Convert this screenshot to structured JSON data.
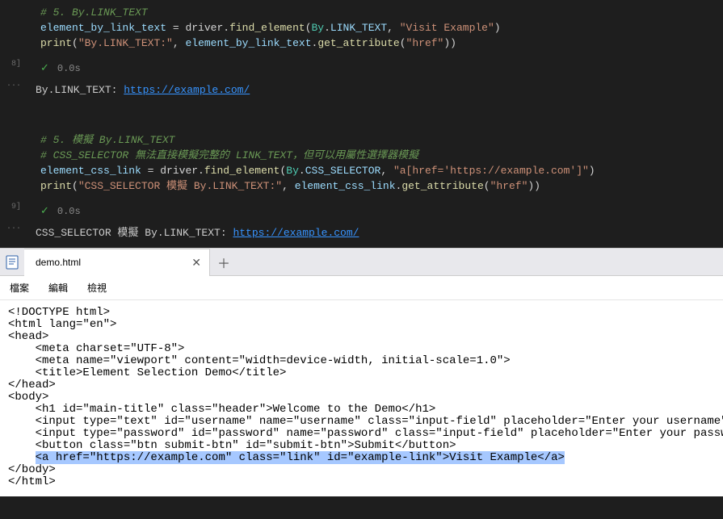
{
  "cell1": {
    "gutter": "8]",
    "comment": "# 5. By.LINK_TEXT",
    "line2": {
      "var": "element_by_link_text",
      "eq": " = ",
      "obj": "driver",
      "dot1": ".",
      "func": "find_element",
      "open": "(",
      "cls": "By",
      "dot2": ".",
      "prop": "LINK_TEXT",
      "comma": ", ",
      "str": "\"Visit Example\"",
      "close": ")"
    },
    "line3": {
      "print": "print",
      "open": "(",
      "str1": "\"By.LINK_TEXT:\"",
      "comma": ", ",
      "var": "element_by_link_text",
      "dot": ".",
      "func": "get_attribute",
      "open2": "(",
      "str2": "\"href\"",
      "close": "))"
    },
    "status_time": "0.0s"
  },
  "out1": {
    "label": "By.LINK_TEXT: ",
    "url": "https://example.com/"
  },
  "cell2": {
    "gutter": "9]",
    "comment1": "# 5. 模擬 By.LINK_TEXT",
    "comment2": "# CSS_SELECTOR 無法直接模擬完整的 LINK_TEXT，但可以用屬性選擇器模擬",
    "line3": {
      "var": "element_css_link",
      "eq": " = ",
      "obj": "driver",
      "dot1": ".",
      "func": "find_element",
      "open": "(",
      "cls": "By",
      "dot2": ".",
      "prop": "CSS_SELECTOR",
      "comma": ", ",
      "str": "\"a[href='https://example.com']\"",
      "close": ")"
    },
    "line4": {
      "print": "print",
      "open": "(",
      "str1": "\"CSS_SELECTOR 模擬 By.LINK_TEXT:\"",
      "comma": ", ",
      "var": "element_css_link",
      "dot": ".",
      "func": "get_attribute",
      "open2": "(",
      "str2": "\"href\"",
      "close": "))"
    },
    "status_time": "0.0s"
  },
  "out2": {
    "label": "CSS_SELECTOR 模擬 By.LINK_TEXT: ",
    "url": "https://example.com/"
  },
  "editor": {
    "tab_name": "demo.html",
    "menu": {
      "file": "檔案",
      "edit": "編輯",
      "view": "檢視"
    },
    "code": {
      "l1": "<!DOCTYPE html>",
      "l2": "<html lang=\"en\">",
      "l3": "<head>",
      "l4": "    <meta charset=\"UTF-8\">",
      "l5": "    <meta name=\"viewport\" content=\"width=device-width, initial-scale=1.0\">",
      "l6": "    <title>Element Selection Demo</title>",
      "l7": "</head>",
      "l8": "<body>",
      "l9": "    <h1 id=\"main-title\" class=\"header\">Welcome to the Demo</h1>",
      "l10": "    <input type=\"text\" id=\"username\" name=\"username\" class=\"input-field\" placeholder=\"Enter your username\">",
      "l11": "    <input type=\"password\" id=\"password\" name=\"password\" class=\"input-field\" placeholder=\"Enter your password\">",
      "l12": "    <button class=\"btn submit-btn\" id=\"submit-btn\">Submit</button>",
      "l13_pre": "    ",
      "l13_hl": "<a href=\"https://example.com\" class=\"link\" id=\"example-link\">Visit Example</a>",
      "l14": "</body>",
      "l15": "</html>"
    }
  }
}
